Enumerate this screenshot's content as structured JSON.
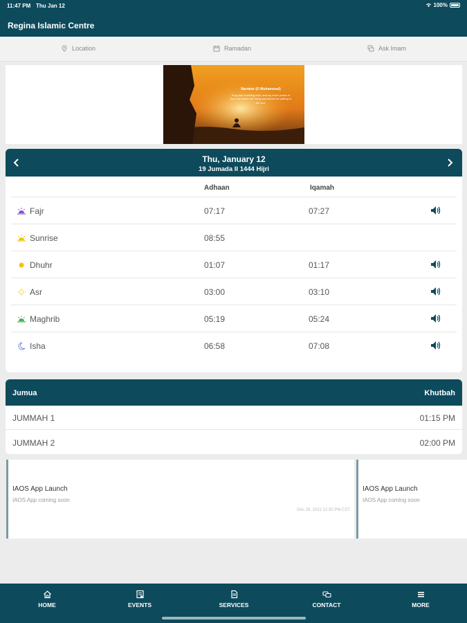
{
  "status": {
    "time": "11:47 PM",
    "date": "Thu Jan 12",
    "battery": "100%"
  },
  "app": {
    "title": "Regina Islamic Centre"
  },
  "subnav": [
    {
      "label": "Location",
      "icon": "map-pin-icon"
    },
    {
      "label": "Ramadan",
      "icon": "calendar-icon"
    },
    {
      "label": "Ask Imam",
      "icon": "chat-icon"
    }
  ],
  "banner": {
    "quote_title": "Narrator (O Muhammad)",
    "quote_text": "Pray with unwitting ears, and lay down praise of thy Lord before the rising and before the setting of the sun."
  },
  "prayer_times": {
    "date": "Thu, January 12",
    "hijri": "19 Jumada II 1444 Hijri",
    "headers": {
      "adhaan": "Adhaan",
      "iqamah": "Iqamah"
    },
    "rows": [
      {
        "name": "Fajr",
        "adhaan": "07:17",
        "iqamah": "07:27",
        "icon": "fajr-icon",
        "sound": true
      },
      {
        "name": "Sunrise",
        "adhaan": "08:55",
        "iqamah": "",
        "icon": "sunrise-icon",
        "sound": false
      },
      {
        "name": "Dhuhr",
        "adhaan": "01:07",
        "iqamah": "01:17",
        "icon": "sun-icon",
        "sound": true
      },
      {
        "name": "Asr",
        "adhaan": "03:00",
        "iqamah": "03:10",
        "icon": "afternoon-sun-icon",
        "sound": true
      },
      {
        "name": "Maghrib",
        "adhaan": "05:19",
        "iqamah": "05:24",
        "icon": "sunset-icon",
        "sound": true
      },
      {
        "name": "Isha",
        "adhaan": "06:58",
        "iqamah": "07:08",
        "icon": "moon-icon",
        "sound": true
      }
    ]
  },
  "jumua": {
    "title": "Jumua",
    "khutbah_label": "Khutbah",
    "rows": [
      {
        "name": "JUMMAH 1",
        "time": "01:15 PM"
      },
      {
        "name": "JUMMAH 2",
        "time": "02:00 PM"
      }
    ]
  },
  "events": [
    {
      "title": "IAOS App Launch",
      "subtitle": "IAOS App coming soon",
      "date": "Dec 28, 2022 12:30 PM CST"
    },
    {
      "title": "IAOS App Launch",
      "subtitle": "IAOS App coming soon",
      "date": ""
    }
  ],
  "tabs": [
    {
      "label": "HOME",
      "icon": "home-icon"
    },
    {
      "label": "EVENTS",
      "icon": "events-icon"
    },
    {
      "label": "SERVICES",
      "icon": "services-icon"
    },
    {
      "label": "CONTACT",
      "icon": "contact-icon"
    },
    {
      "label": "MORE",
      "icon": "menu-icon"
    }
  ],
  "colors": {
    "primary": "#0d4a5c",
    "background": "#ececec",
    "fajr": "#8a4fd8",
    "sun": "#f5c400",
    "maghrib": "#4caf50",
    "isha": "#7d8fd8"
  }
}
